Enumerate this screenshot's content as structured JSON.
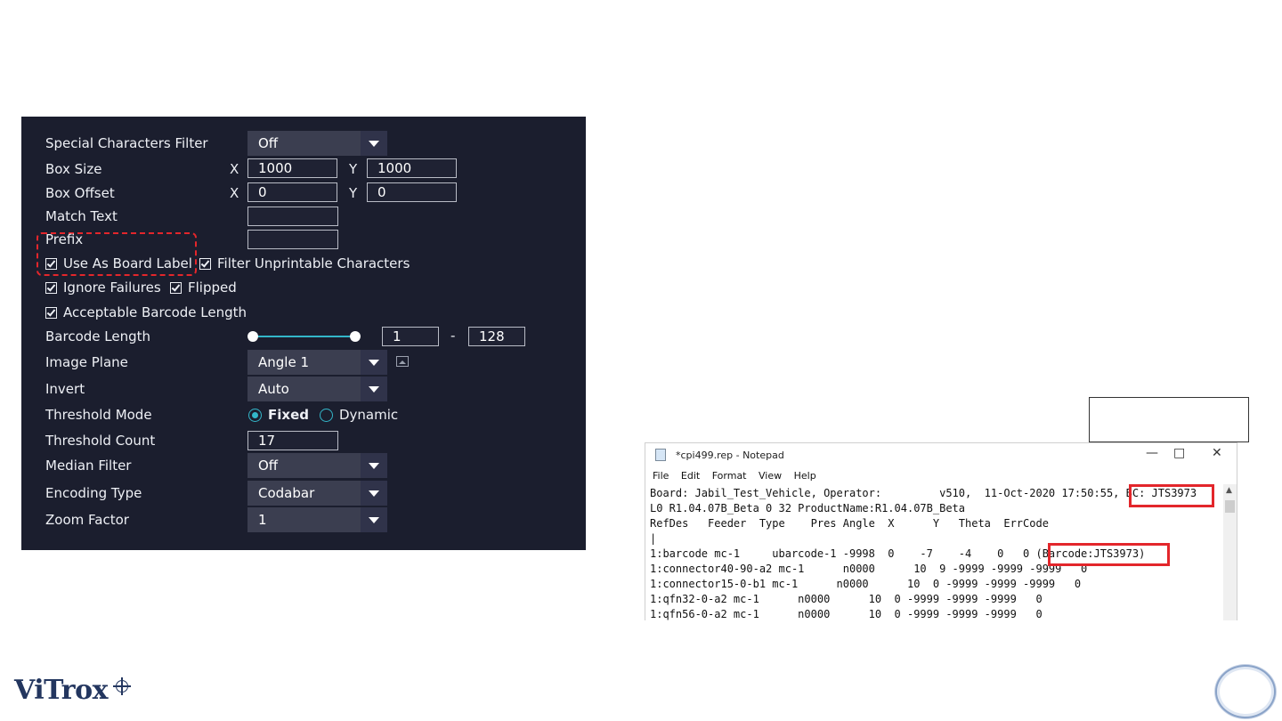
{
  "panel": {
    "special_chars_filter": {
      "label": "Special Characters Filter",
      "value": "Off"
    },
    "box_size": {
      "label": "Box Size",
      "x_label": "X",
      "x": "1000",
      "y_label": "Y",
      "y": "1000"
    },
    "box_offset": {
      "label": "Box Offset",
      "x_label": "X",
      "x": "0",
      "y_label": "Y",
      "y": "0"
    },
    "match_text": {
      "label": "Match Text",
      "value": ""
    },
    "prefix": {
      "label": "Prefix",
      "value": ""
    },
    "use_as_board_label": {
      "label": "Use As Board Label",
      "checked": true
    },
    "filter_unprintable": {
      "label": "Filter Unprintable Characters",
      "checked": true
    },
    "ignore_failures": {
      "label": "Ignore Failures",
      "checked": true
    },
    "flipped": {
      "label": "Flipped",
      "checked": true
    },
    "acceptable_barcode_length": {
      "label": "Acceptable Barcode Length",
      "checked": true
    },
    "barcode_length": {
      "label": "Barcode Length",
      "min": "1",
      "separator": "-",
      "max": "128"
    },
    "image_plane": {
      "label": "Image Plane",
      "value": "Angle 1"
    },
    "invert": {
      "label": "Invert",
      "value": "Auto"
    },
    "threshold_mode": {
      "label": "Threshold Mode",
      "option_fixed": "Fixed",
      "option_dynamic": "Dynamic",
      "selected": "Fixed"
    },
    "threshold_count": {
      "label": "Threshold Count",
      "value": "17"
    },
    "median_filter": {
      "label": "Median Filter",
      "value": "Off"
    },
    "encoding_type": {
      "label": "Encoding Type",
      "value": "Codabar"
    },
    "zoom_factor": {
      "label": "Zoom Factor",
      "value": "1"
    },
    "accent_color": "#33b6c9",
    "highlight_color": "#e3262b"
  },
  "notepad": {
    "title": "*cpi499.rep - Notepad",
    "window_controls": [
      "—",
      "□",
      "✕"
    ],
    "menu": [
      "File",
      "Edit",
      "Format",
      "View",
      "Help"
    ],
    "lines": [
      "Board: Jabil_Test_Vehicle, Operator:         v510,  11-Oct-2020 17:50:55, BC: JTS3973",
      "L0 R1.04.07B_Beta 0 32 ProductName:R1.04.07B_Beta",
      "RefDes   Feeder  Type    Pres Angle  X      Y   Theta  ErrCode",
      "|",
      "1:barcode mc-1     ubarcode-1 -9998  0    -7    -4    0   0 (Barcode:JTS3973)",
      "1:connector40-90-a2 mc-1      n0000      10  9 -9999 -9999 -9999   0",
      "1:connector15-0-b1 mc-1      n0000      10  0 -9999 -9999 -9999   0",
      "1:qfn32-0-a2 mc-1      n0000      10  0 -9999 -9999 -9999   0",
      "1:qfn56-0-a2 mc-1      n0000      10  0 -9999 -9999 -9999   0"
    ]
  },
  "logo": {
    "text": "ViTrox"
  }
}
